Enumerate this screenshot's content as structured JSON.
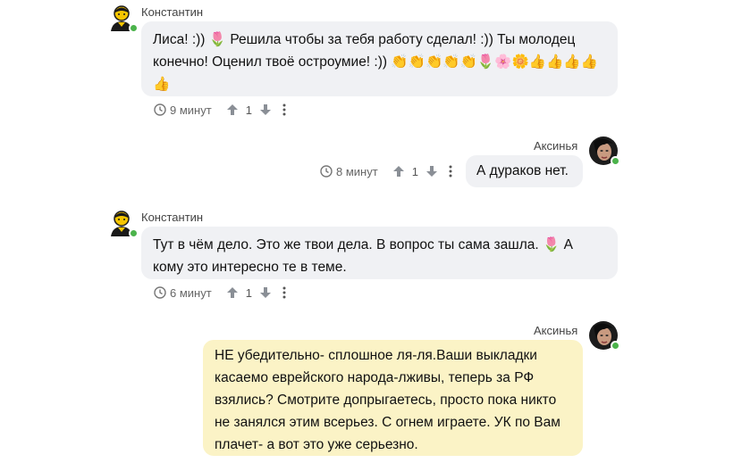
{
  "messages": [
    {
      "author": "Константин",
      "text": "Лиса! :)) 🌷 Решила чтобы за тебя работу сделал! :)) Ты молодец конечно! Оценил твоё остроумие! :)) 👏👏👏👏👏🌷🌸🌼👍👍👍👍👍",
      "time": "9 минут",
      "votes": "1"
    },
    {
      "author": "Аксинья",
      "text": "А дураков нет.",
      "time": "8 минут",
      "votes": "1"
    },
    {
      "author": "Константин",
      "text": "Тут в чём дело. Это же твои дела. В вопрос ты сама зашла. 🌷 А кому это интересно те в теме.",
      "time": "6 минут",
      "votes": "1"
    },
    {
      "author": "Аксинья",
      "text": "НЕ убедительно- сплошное ля-ля.Ваши выкладки касаемо еврейского народа-лживы, теперь за РФ взялись? Смотрите допрыгаетесь, просто пока никто не занялся этим всерьез. С огнем играете. УК по Вам плачет- а вот это уже серьезно."
    }
  ],
  "colors": {
    "bubble_grey": "#f0f1f4",
    "bubble_yellow": "#fbf3c6",
    "online": "#4bb34b",
    "meta_text": "#666666"
  },
  "icons": {
    "avatar_konstantin": "yellow-man-avatar-icon",
    "avatar_aksinya": "woman-photo-avatar-icon",
    "time": "clock-icon",
    "upvote": "arrow-up-icon",
    "downvote": "arrow-down-icon",
    "more": "vertical-dots-icon"
  }
}
